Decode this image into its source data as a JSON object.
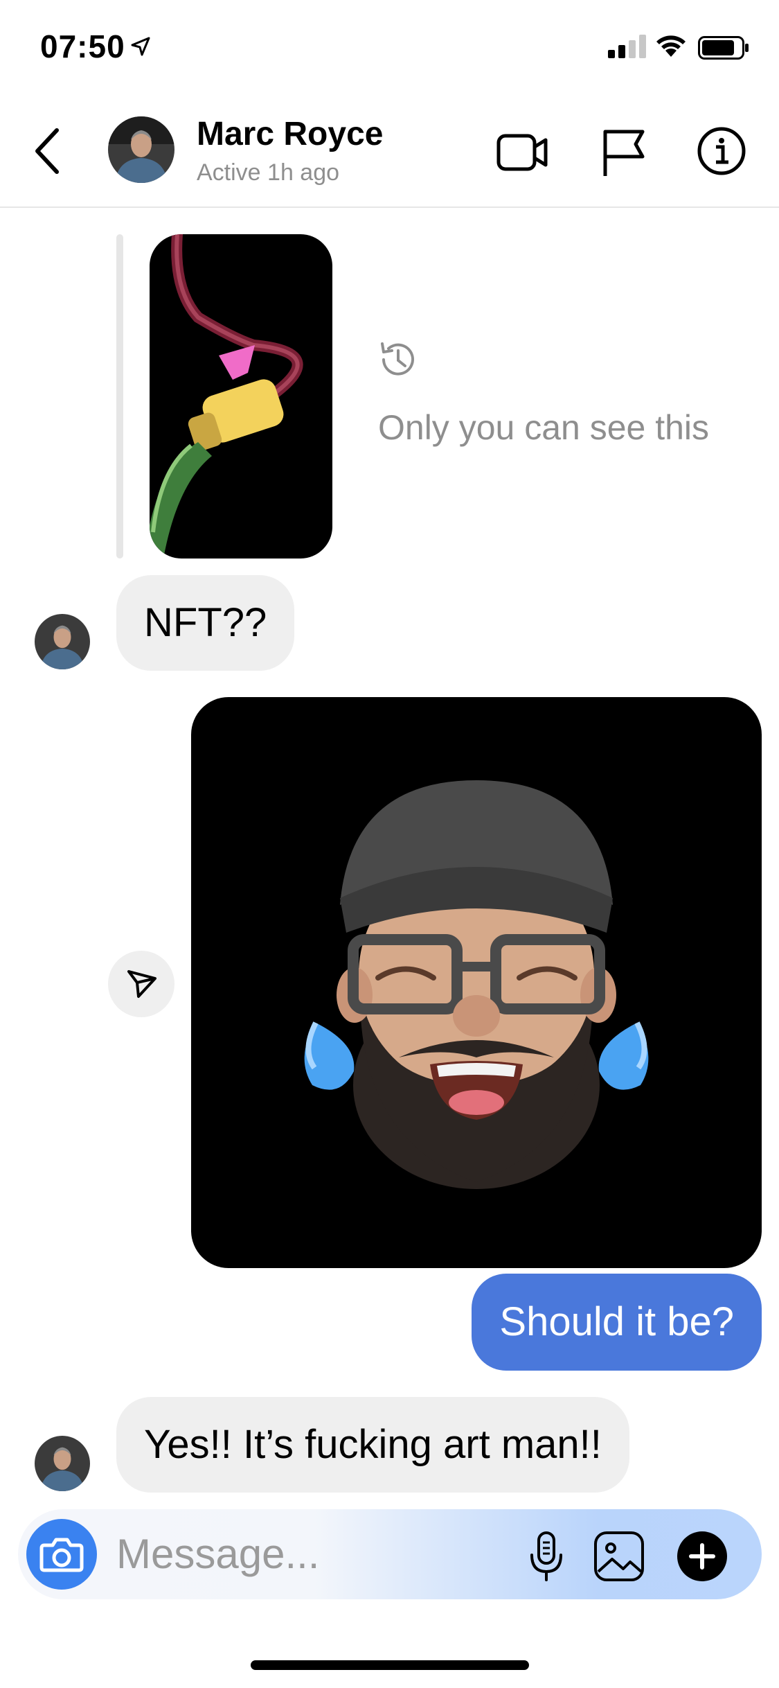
{
  "status_bar": {
    "time": "07:50"
  },
  "header": {
    "contact_name": "Marc Royce",
    "activity": "Active 1h ago"
  },
  "messages": {
    "story_reply_note": "Only you can see this",
    "incoming_1": "NFT??",
    "outgoing_1": "Should it be?",
    "incoming_2": "Yes!! It’s fucking art man!!"
  },
  "composer": {
    "placeholder": "Message..."
  },
  "icons": {
    "back": "chevron-left-icon",
    "video": "video-camera-icon",
    "flag": "flag-icon",
    "info": "info-icon",
    "history": "history-icon",
    "share": "paper-plane-icon",
    "camera": "camera-icon",
    "mic": "microphone-icon",
    "gallery": "image-icon",
    "plus": "plus-icon"
  },
  "colors": {
    "outgoing_bubble": "#4a78db",
    "incoming_bubble": "#efefef",
    "camera_button": "#3a82f0"
  }
}
